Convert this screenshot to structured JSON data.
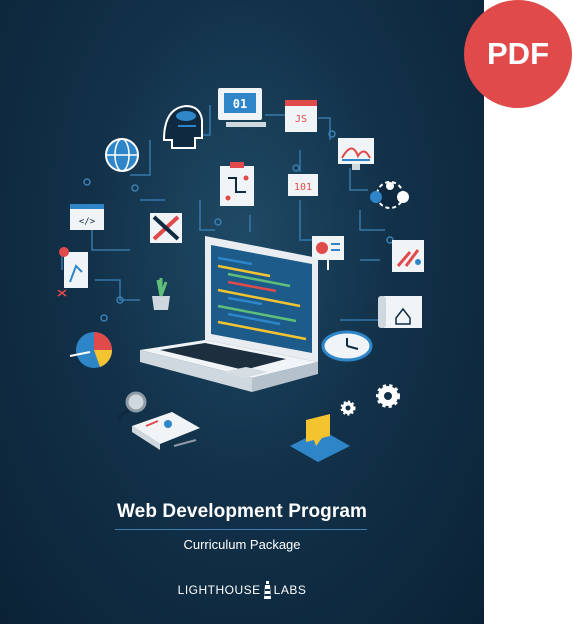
{
  "cover": {
    "title": "Web Development Program",
    "subtitle": "Curriculum Package",
    "brand_left": "LIGHTHOUSE",
    "brand_right": "LABS"
  },
  "badge": {
    "label": "PDF"
  },
  "colors": {
    "background": "#123149",
    "accent_blue": "#2e86c9",
    "badge_red": "#e04a4a",
    "icon_yellow": "#f4c430"
  },
  "art": {
    "code_labels": {
      "binary_01": "01",
      "js": "JS",
      "binary_101": "101",
      "html_tag": "</>"
    }
  }
}
